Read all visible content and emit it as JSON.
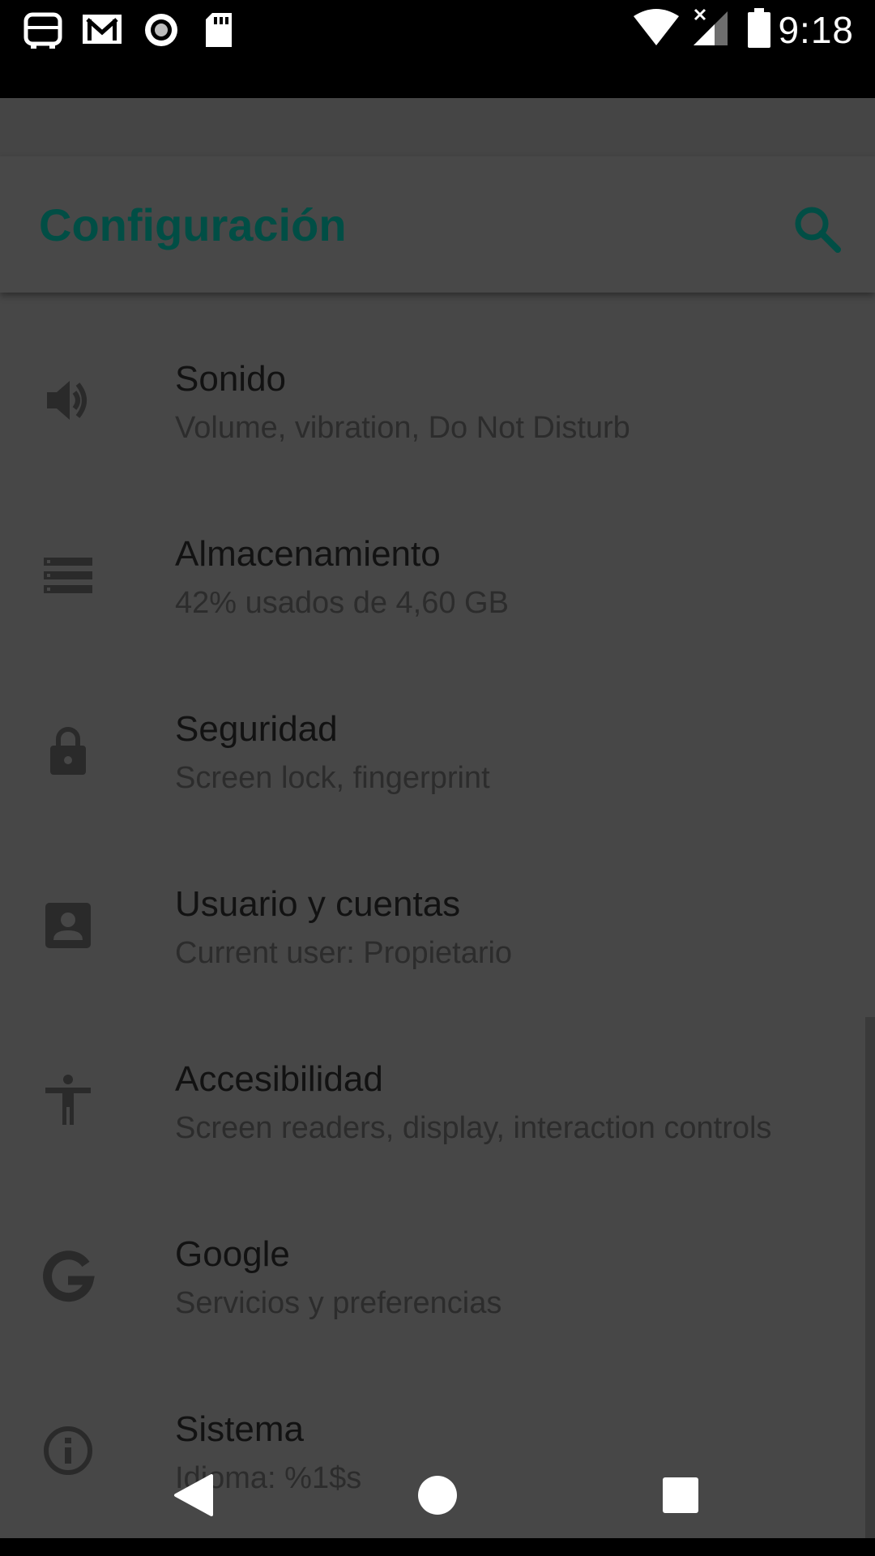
{
  "status_bar": {
    "time": "9:18",
    "icons": [
      "bus-icon",
      "gmail-icon",
      "record-icon",
      "sd-card-icon",
      "wifi-icon",
      "cell-signal-off-icon",
      "battery-icon"
    ]
  },
  "app_bar": {
    "title": "Configuración",
    "search_icon": "search-icon"
  },
  "colors": {
    "title": "#014e45",
    "background": "#474747",
    "icon": "#2a2a2a"
  },
  "settings": {
    "items": [
      {
        "icon": "volume-icon",
        "title": "Sonido",
        "subtitle": "Volume, vibration, Do Not Disturb"
      },
      {
        "icon": "storage-icon",
        "title": "Almacenamiento",
        "subtitle": "42% usados de 4,60 GB"
      },
      {
        "icon": "lock-icon",
        "title": "Seguridad",
        "subtitle": "Screen lock, fingerprint"
      },
      {
        "icon": "account-icon",
        "title": "Usuario y cuentas",
        "subtitle": "Current user: Propietario"
      },
      {
        "icon": "accessibility-icon",
        "title": "Accesibilidad",
        "subtitle": "Screen readers, display, interaction controls"
      },
      {
        "icon": "google-icon",
        "title": "Google",
        "subtitle": "Servicios y preferencias"
      },
      {
        "icon": "info-icon",
        "title": "Sistema",
        "subtitle": "Idioma: %1$s"
      }
    ]
  },
  "nav_bar": {
    "back": "back-icon",
    "home": "home-icon",
    "recents": "recents-icon"
  }
}
